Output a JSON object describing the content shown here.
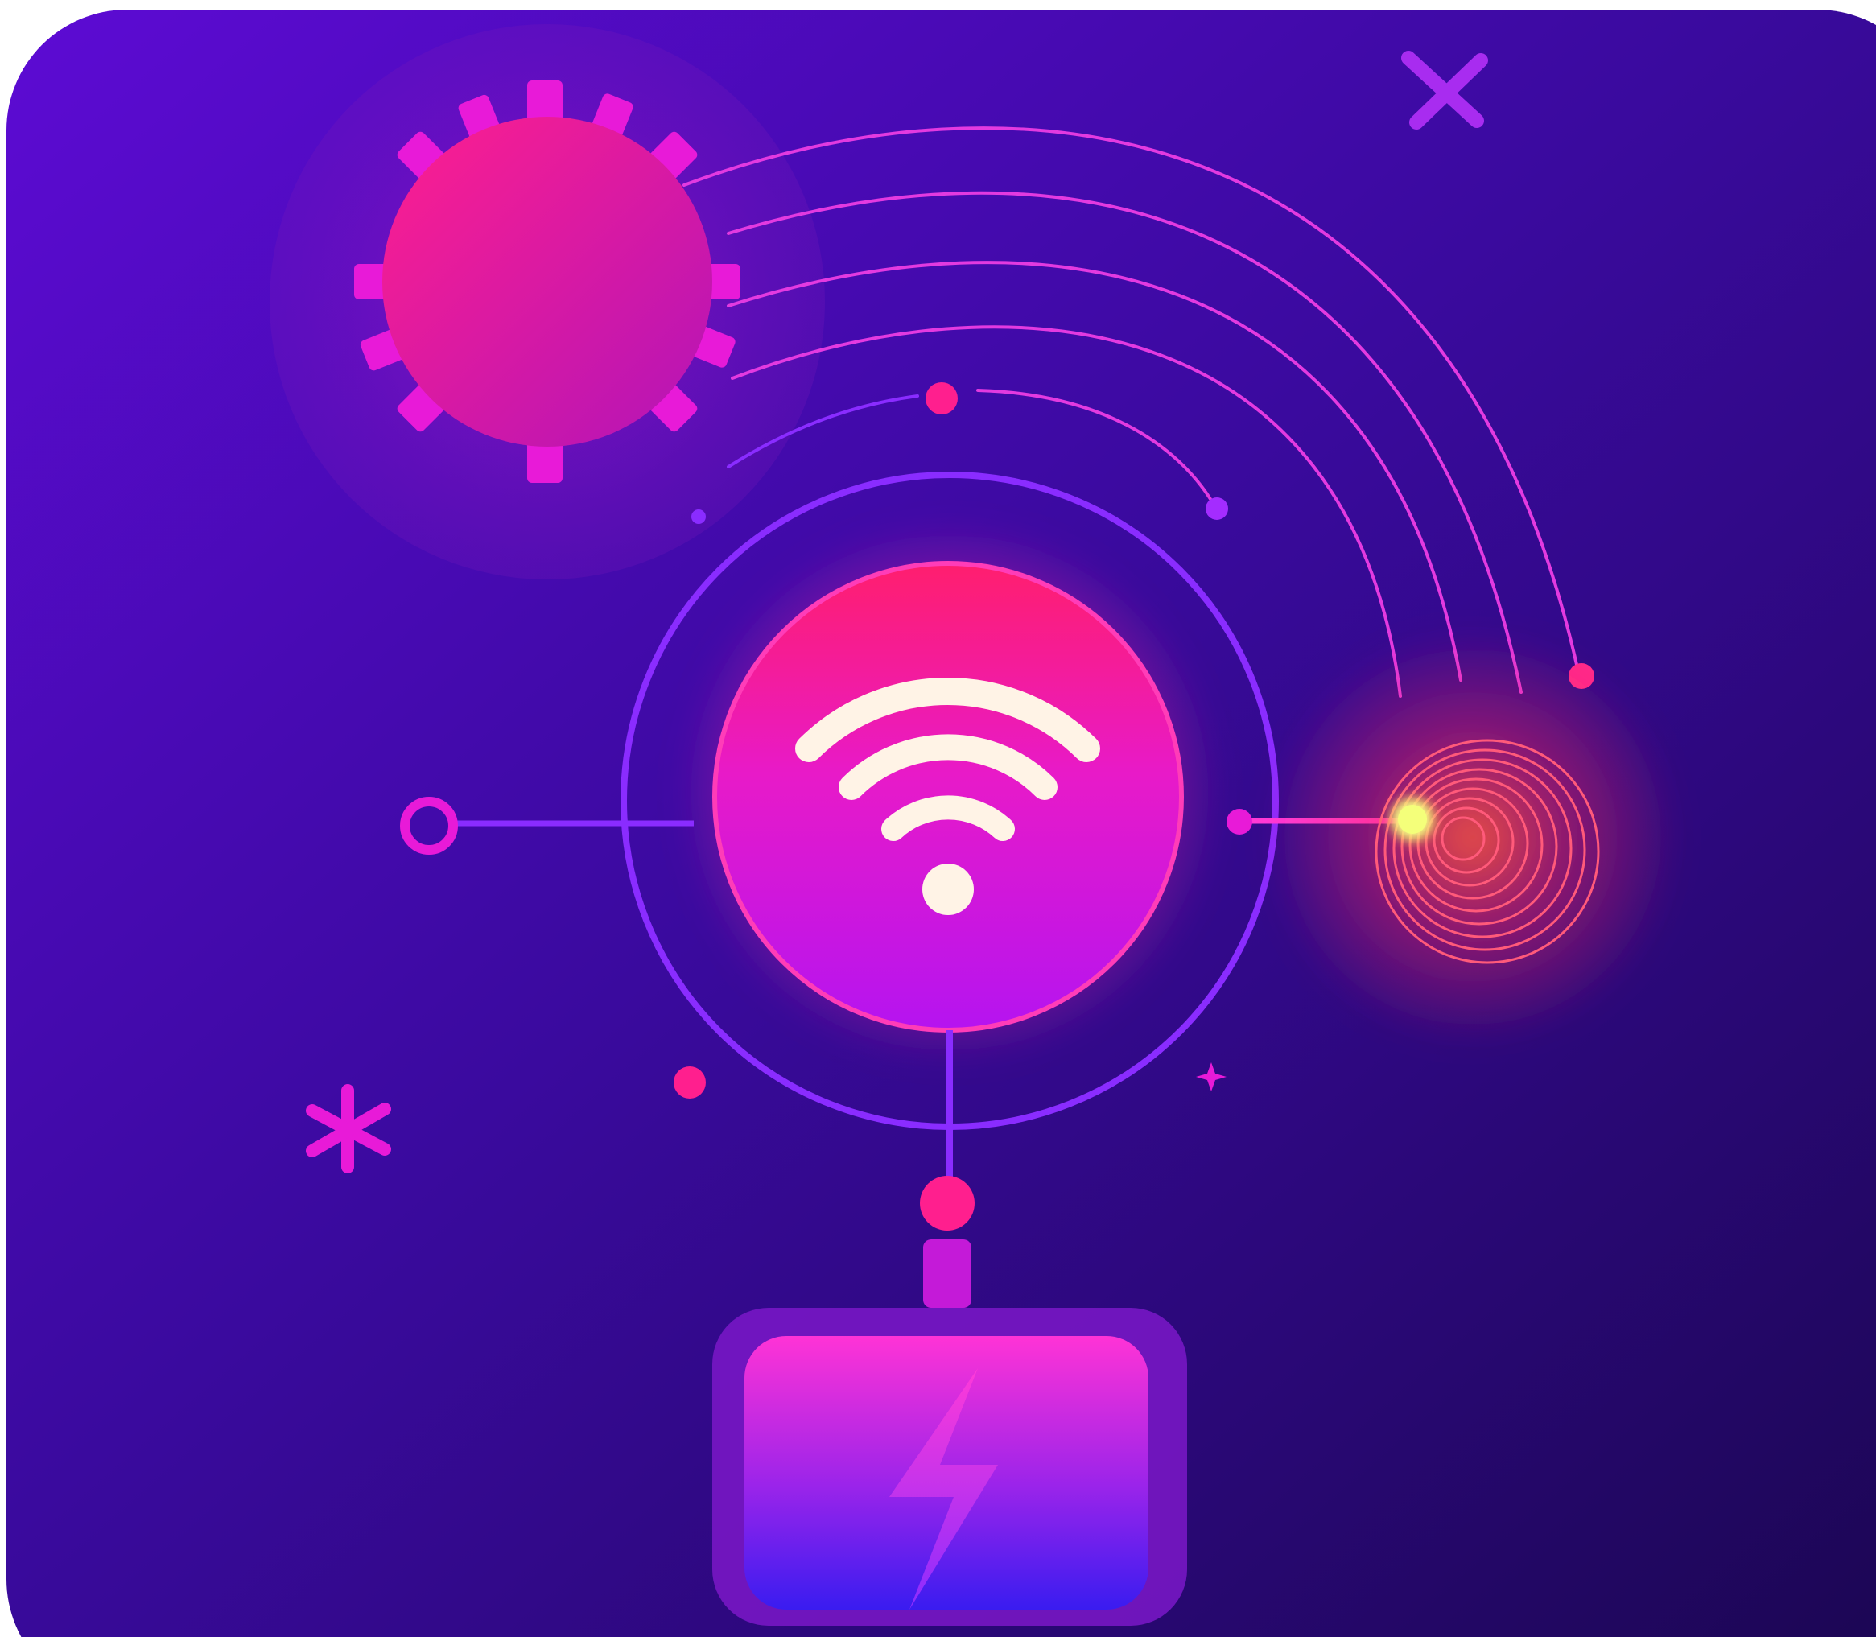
{
  "palette": {
    "background_top_left": "#5d0bd4",
    "background_mid": "#3a0a9e",
    "background_bottom_right": "#1a0650",
    "hot_pink": "#ff1f8e",
    "magenta": "#e21bd8",
    "violet_ring": "#8a2cff",
    "glow_yellow": "#f4ff7a",
    "glow_red": "#ff3a55",
    "wifi_white": "#fff3e6",
    "battery_top": "#ff33d6",
    "battery_bottom": "#3a1cf0"
  },
  "icons": {
    "central": "wifi-icon",
    "top_left": "gear-icon",
    "bottom": "battery-lightning-icon",
    "right": "signal-target-icon",
    "decor": [
      "sparkle-icon",
      "sparkle-icon",
      "twinkle-icon"
    ]
  }
}
